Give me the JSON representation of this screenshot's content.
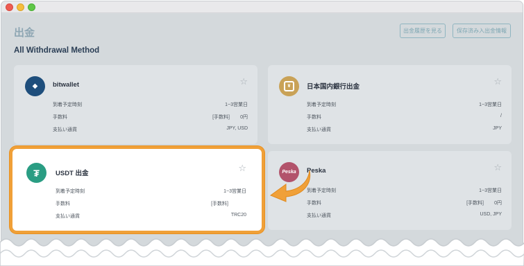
{
  "page": {
    "title": "出金",
    "history_button": "出金履歴を見る",
    "saved_button": "保存済み入出金情報",
    "section_title": "All Withdrawal Method"
  },
  "methods": [
    {
      "name": "bitwallet",
      "logo_icon": "bitwallet-logo",
      "arrival_label": "到着予定時刻",
      "arrival_value": "1~3営業日",
      "fee_label": "手数料",
      "fee_tag": "[手数料]",
      "fee_value": "0円",
      "currency_label": "支払い通貨",
      "currency_value": "JPY, USD"
    },
    {
      "name": "日本国内銀行出金",
      "logo_icon": "bank-logo",
      "arrival_label": "到着予定時刻",
      "arrival_value": "1~3営業日",
      "fee_label": "手数料",
      "fee_tag": "",
      "fee_value": "/",
      "currency_label": "支払い通貨",
      "currency_value": "JPY"
    },
    {
      "name": "USDT 出金",
      "logo_icon": "tether-logo",
      "arrival_label": "到着予定時刻",
      "arrival_value": "1~3営業日",
      "fee_label": "手数料",
      "fee_tag": "[手数料]",
      "fee_value": "",
      "currency_label": "支払い通貨",
      "currency_value": "TRC20"
    },
    {
      "name": "Peska",
      "logo_icon": "peska-logo",
      "logo_text": "Peska",
      "arrival_label": "到着予定時刻",
      "arrival_value": "1~3営業日",
      "fee_label": "手数料",
      "fee_tag": "[手数料]",
      "fee_value": "0円",
      "currency_label": "支払い通貨",
      "currency_value": "USD, JPY"
    }
  ],
  "colors": {
    "accent": "#f0a038",
    "tether": "#2a9d83",
    "bitwallet": "#1e4e7c",
    "bank": "#c9a257",
    "peska": "#b2536b"
  }
}
